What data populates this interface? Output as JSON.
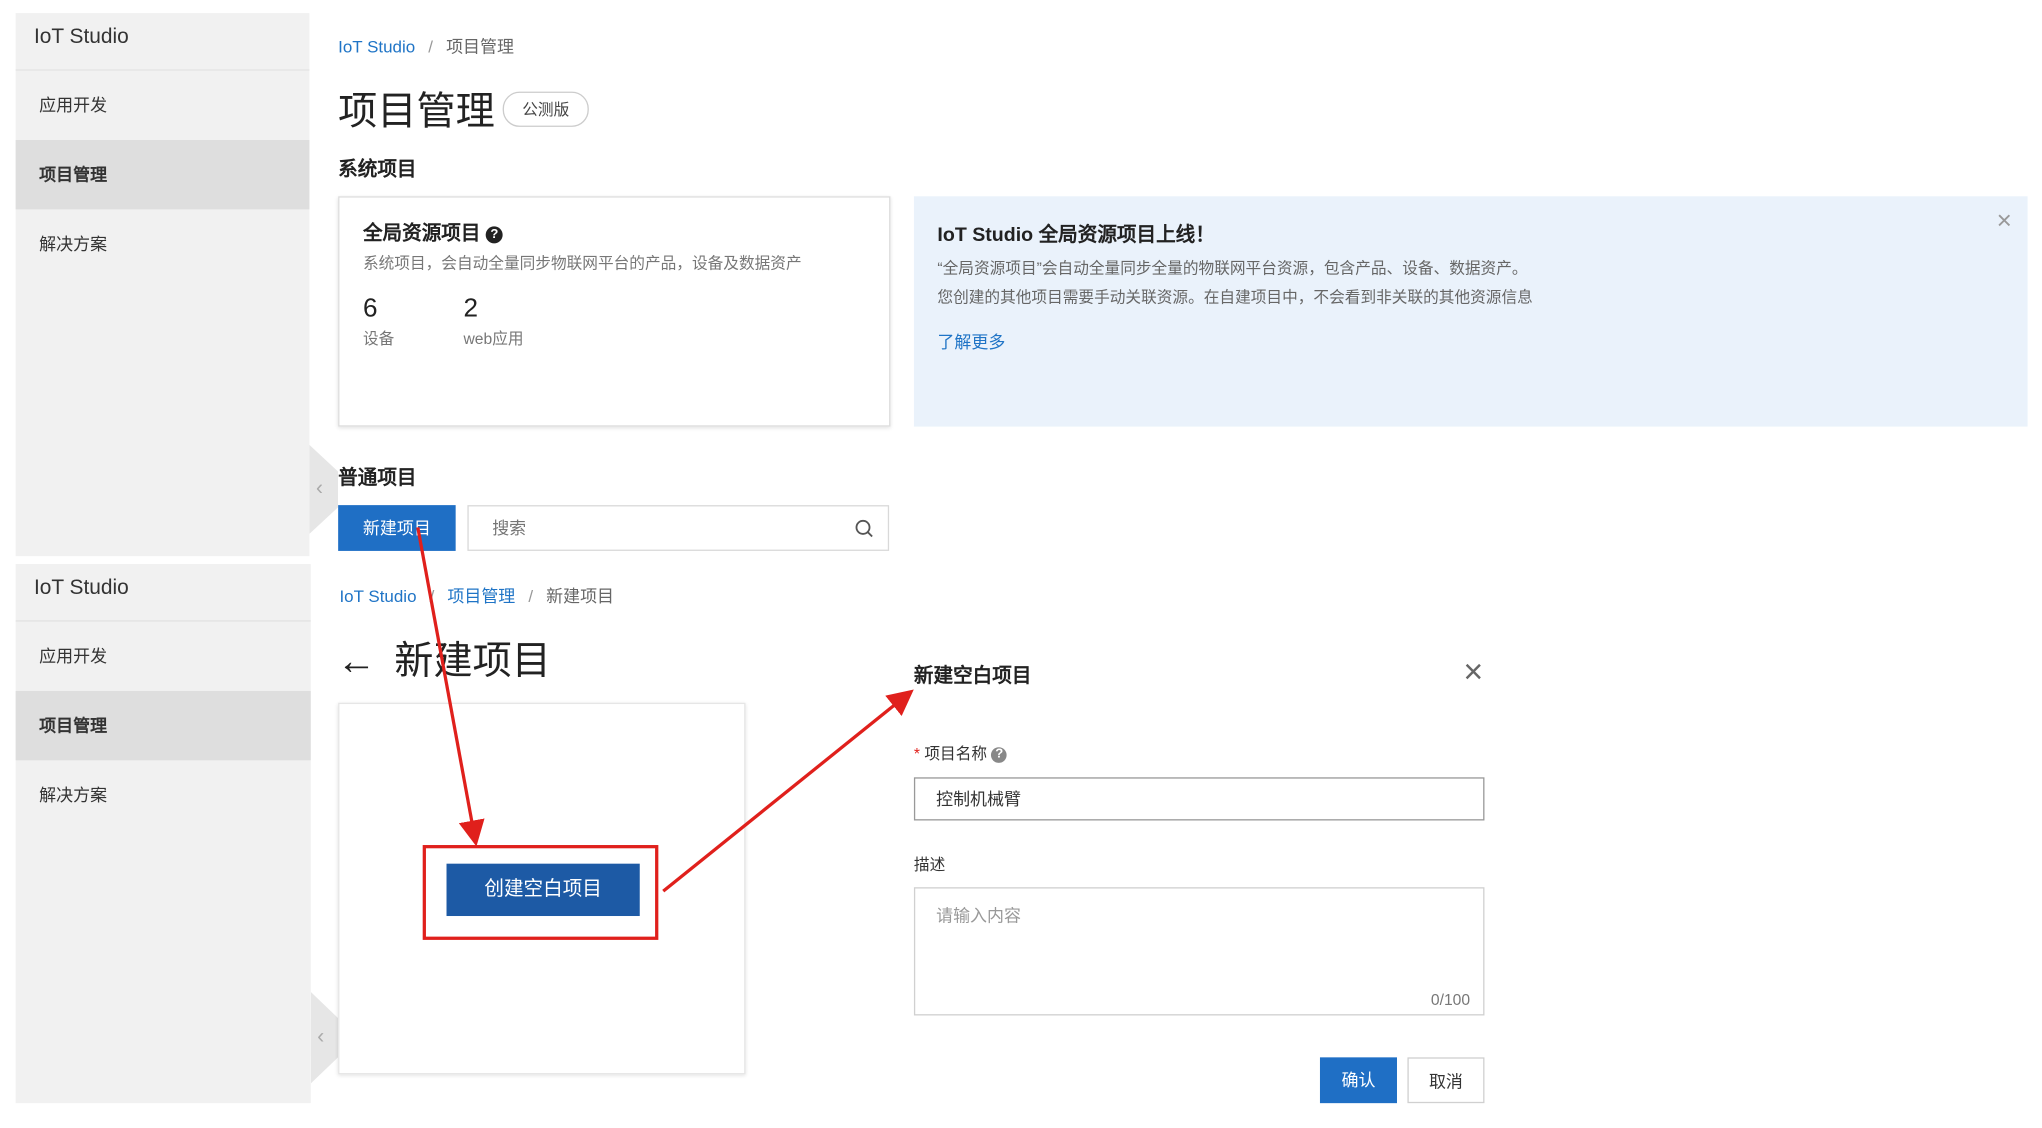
{
  "top": {
    "sidebar": {
      "title": "IoT Studio",
      "items": [
        {
          "label": "应用开发",
          "active": false
        },
        {
          "label": "项目管理",
          "active": true
        },
        {
          "label": "解决方案",
          "active": false
        }
      ]
    },
    "breadcrumb": {
      "home": "IoT Studio",
      "sep": "/",
      "current": "项目管理"
    },
    "page_title": "项目管理",
    "beta_badge": "公测版",
    "system_section": "系统项目",
    "global_card": {
      "title": "全局资源项目",
      "description": "系统项目，会自动全量同步物联网平台的产品，设备及数据资产",
      "stats": [
        {
          "value": "6",
          "label": "设备"
        },
        {
          "value": "2",
          "label": "web应用"
        }
      ]
    },
    "notice": {
      "title": "IoT Studio 全局资源项目上线！",
      "line1": "“全局资源项目”会自动全量同步全量的物联网平台资源，包含产品、设备、数据资产。",
      "line2": "您创建的其他项目需要手动关联资源。在自建项目中，不会看到非关联的其他资源信息",
      "link": "了解更多",
      "close": "×"
    },
    "normal_section": "普通项目",
    "new_button": "新建项目",
    "search_placeholder": "搜索"
  },
  "bottom": {
    "sidebar": {
      "title": "IoT Studio",
      "items": [
        {
          "label": "应用开发",
          "active": false
        },
        {
          "label": "项目管理",
          "active": true
        },
        {
          "label": "解决方案",
          "active": false
        }
      ]
    },
    "breadcrumb": {
      "home": "IoT Studio",
      "sep": "/",
      "parent": "项目管理",
      "current": "新建项目"
    },
    "back_arrow": "←",
    "page_title": "新建项目",
    "create_blank_button": "创建空白项目",
    "dialog": {
      "title": "新建空白项目",
      "close": "×",
      "name_required": "*",
      "name_label": "项目名称",
      "name_value": "控制机械臂",
      "desc_label": "描述",
      "desc_placeholder": "请输入内容",
      "counter": "0/100",
      "confirm": "确认",
      "cancel": "取消"
    }
  },
  "icons": {
    "help": "question-circle-icon",
    "search": "search-icon",
    "close": "close-icon",
    "collapse": "chevron-left-icon",
    "back": "arrow-left-icon"
  },
  "colors": {
    "primary": "#1f6fc5",
    "dark_primary": "#1d5aa5",
    "link": "#1f74c6",
    "annotation": "#e0201c",
    "notice_bg": "#eaf2fb",
    "sidebar_bg": "#f1f1f1"
  }
}
